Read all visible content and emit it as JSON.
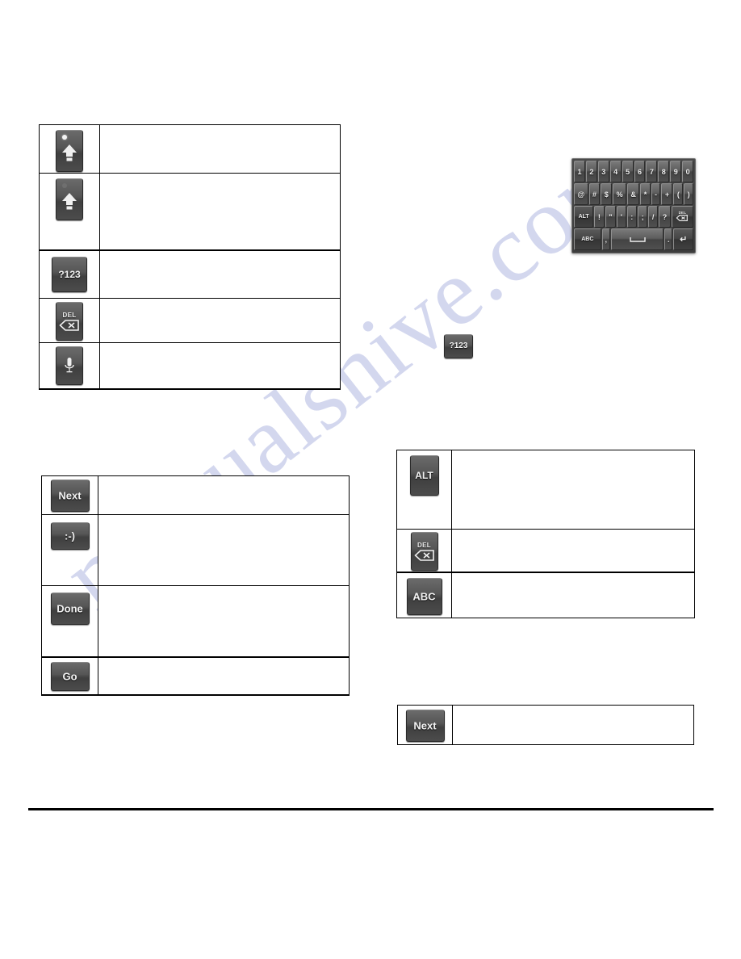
{
  "document": {
    "watermark": "manualshive.com"
  },
  "tables": {
    "shift_and_special_keys": {
      "name": "left-upper-key-table",
      "rows": [
        {
          "key": {
            "name": "shift-caps-lock-key",
            "glyph": "shift-arrow-with-dot-icon",
            "label": ""
          },
          "description": ""
        },
        {
          "key": {
            "name": "shift-key",
            "glyph": "shift-arrow-icon",
            "label": ""
          },
          "description": ""
        },
        {
          "key": {
            "name": "symbols-key",
            "glyph": "text-key",
            "label": "?123"
          },
          "description": ""
        },
        {
          "key": {
            "name": "delete-key",
            "glyph": "delete-backspace-icon",
            "label": "DEL"
          },
          "description": ""
        },
        {
          "key": {
            "name": "voice-input-key",
            "glyph": "microphone-icon",
            "label": ""
          },
          "description": ""
        }
      ]
    },
    "action_keys": {
      "name": "left-lower-key-table",
      "rows": [
        {
          "key": {
            "name": "next-key",
            "glyph": "text-key",
            "label": "Next"
          },
          "description": ""
        },
        {
          "key": {
            "name": "emoticon-key",
            "glyph": "text-key",
            "label": ":-)"
          },
          "description": ""
        },
        {
          "key": {
            "name": "done-key",
            "glyph": "text-key",
            "label": "Done"
          },
          "description": ""
        },
        {
          "key": {
            "name": "go-key",
            "glyph": "text-key",
            "label": "Go"
          },
          "description": ""
        }
      ]
    },
    "numeric_mode_keys": {
      "name": "right-upper-key-table",
      "rows": [
        {
          "key": {
            "name": "alt-key",
            "glyph": "text-key",
            "label": "ALT"
          },
          "description": ""
        },
        {
          "key": {
            "name": "delete-key",
            "glyph": "delete-backspace-icon",
            "label": "DEL"
          },
          "description": ""
        },
        {
          "key": {
            "name": "abc-key",
            "glyph": "text-key",
            "label": "ABC"
          },
          "description": ""
        }
      ]
    },
    "next_key_table": {
      "name": "right-lower-key-table",
      "rows": [
        {
          "key": {
            "name": "next-key",
            "glyph": "text-key",
            "label": "Next"
          },
          "description": ""
        }
      ]
    }
  },
  "standalone_key": {
    "name": "symbols-key-standalone",
    "label": "?123"
  },
  "keyboard_figure": {
    "name": "android-numeric-symbol-keyboard",
    "rows": [
      {
        "id": "numbers-row",
        "keys": [
          {
            "label": "1",
            "type": "char"
          },
          {
            "label": "2",
            "type": "char"
          },
          {
            "label": "3",
            "type": "char"
          },
          {
            "label": "4",
            "type": "char"
          },
          {
            "label": "5",
            "type": "char"
          },
          {
            "label": "6",
            "type": "char"
          },
          {
            "label": "7",
            "type": "char"
          },
          {
            "label": "8",
            "type": "char"
          },
          {
            "label": "9",
            "type": "char"
          },
          {
            "label": "0",
            "type": "char"
          }
        ]
      },
      {
        "id": "symbols-row",
        "keys": [
          {
            "label": "@",
            "type": "char"
          },
          {
            "label": "#",
            "type": "char"
          },
          {
            "label": "$",
            "type": "char"
          },
          {
            "label": "%",
            "type": "char"
          },
          {
            "label": "&",
            "type": "char"
          },
          {
            "label": "*",
            "type": "char"
          },
          {
            "label": "-",
            "type": "char"
          },
          {
            "label": "+",
            "type": "char"
          },
          {
            "label": "(",
            "type": "char"
          },
          {
            "label": ")",
            "type": "char"
          }
        ]
      },
      {
        "id": "punctuation-row",
        "keys": [
          {
            "label": "ALT",
            "type": "alt"
          },
          {
            "label": "!",
            "type": "char"
          },
          {
            "label": "\"",
            "type": "char"
          },
          {
            "label": "'",
            "type": "char"
          },
          {
            "label": ":",
            "type": "char"
          },
          {
            "label": ";",
            "type": "char"
          },
          {
            "label": "/",
            "type": "char"
          },
          {
            "label": "?",
            "type": "char"
          },
          {
            "label": "DEL",
            "type": "del"
          }
        ]
      },
      {
        "id": "bottom-row",
        "keys": [
          {
            "label": "ABC",
            "type": "abc"
          },
          {
            "label": ",",
            "type": "narrow"
          },
          {
            "label": "",
            "type": "space"
          },
          {
            "label": ".",
            "type": "narrow"
          },
          {
            "label": "↵",
            "type": "enter"
          }
        ]
      }
    ]
  },
  "colors": {
    "key_face_light": "#6b6b6b",
    "key_face_dark": "#3f3f3f",
    "key_text": "#f2f2f2",
    "keyboard_bg": "#434343",
    "border": "#000000",
    "watermark": "#b9bfe4"
  }
}
